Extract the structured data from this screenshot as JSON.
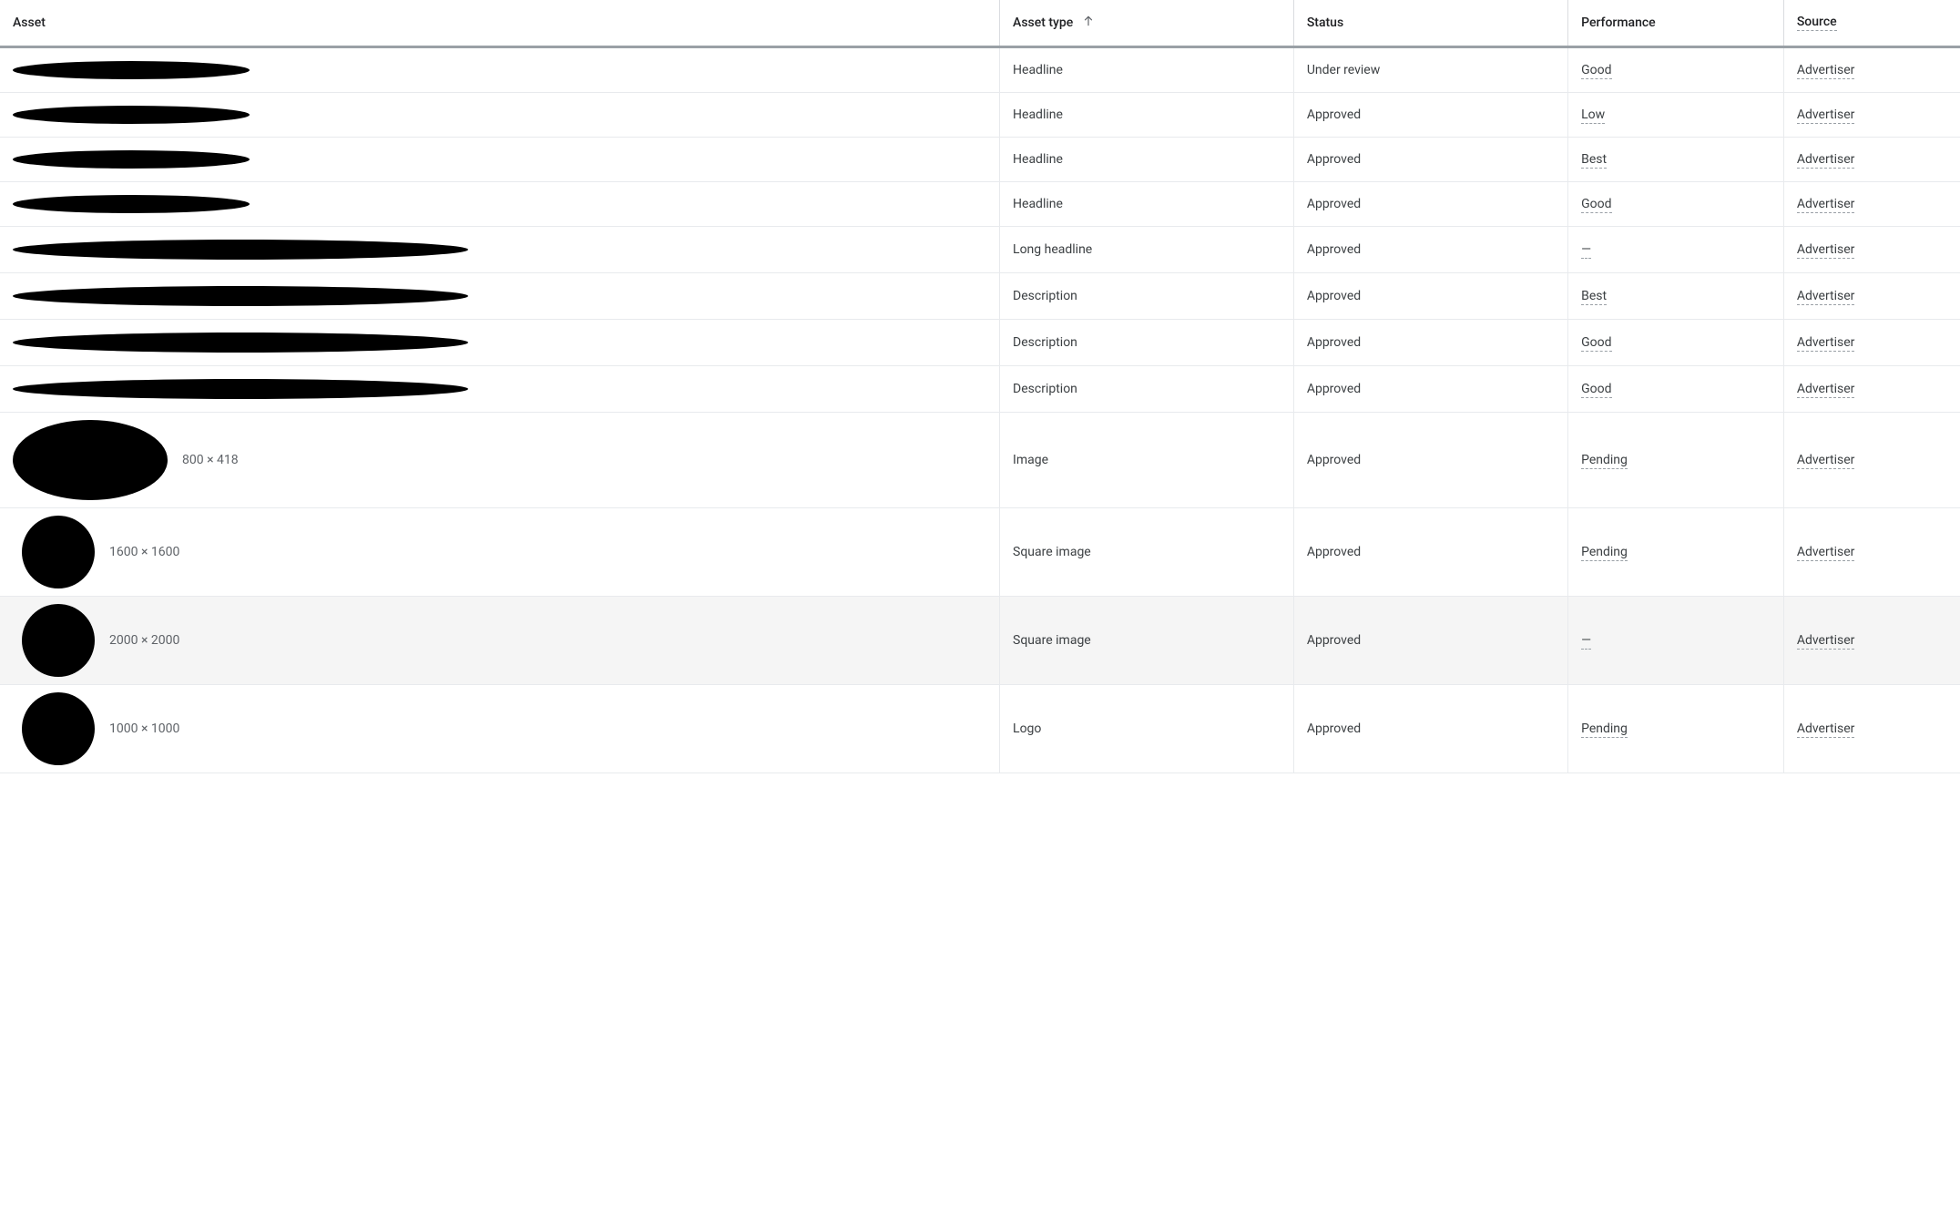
{
  "headers": {
    "asset": "Asset",
    "asset_type": "Asset type",
    "status": "Status",
    "performance": "Performance",
    "source": "Source"
  },
  "sort": {
    "column": "asset_type",
    "direction": "asc"
  },
  "rows": [
    {
      "kind": "text-short",
      "asset_type": "Headline",
      "status": "Under review",
      "performance": "Good",
      "source": "Advertiser",
      "highlighted": false
    },
    {
      "kind": "text-short",
      "asset_type": "Headline",
      "status": "Approved",
      "performance": "Low",
      "source": "Advertiser",
      "highlighted": false
    },
    {
      "kind": "text-short",
      "asset_type": "Headline",
      "status": "Approved",
      "performance": "Best",
      "source": "Advertiser",
      "highlighted": false
    },
    {
      "kind": "text-short",
      "asset_type": "Headline",
      "status": "Approved",
      "performance": "Good",
      "source": "Advertiser",
      "highlighted": false
    },
    {
      "kind": "text-long",
      "asset_type": "Long headline",
      "status": "Approved",
      "performance": "—",
      "source": "Advertiser",
      "highlighted": false
    },
    {
      "kind": "text-long",
      "asset_type": "Description",
      "status": "Approved",
      "performance": "Best",
      "source": "Advertiser",
      "highlighted": false
    },
    {
      "kind": "text-long",
      "asset_type": "Description",
      "status": "Approved",
      "performance": "Good",
      "source": "Advertiser",
      "highlighted": false
    },
    {
      "kind": "text-long",
      "asset_type": "Description",
      "status": "Approved",
      "performance": "Good",
      "source": "Advertiser",
      "highlighted": false
    },
    {
      "kind": "image-wide",
      "dimensions": "800 × 418",
      "asset_type": "Image",
      "status": "Approved",
      "performance": "Pending",
      "source": "Advertiser",
      "highlighted": false
    },
    {
      "kind": "image-square",
      "dimensions": "1600 × 1600",
      "asset_type": "Square image",
      "status": "Approved",
      "performance": "Pending",
      "source": "Advertiser",
      "highlighted": false
    },
    {
      "kind": "image-square",
      "dimensions": "2000 × 2000",
      "asset_type": "Square image",
      "status": "Approved",
      "performance": "—",
      "source": "Advertiser",
      "highlighted": true
    },
    {
      "kind": "image-square",
      "dimensions": "1000 × 1000",
      "asset_type": "Logo",
      "status": "Approved",
      "performance": "Pending",
      "source": "Advertiser",
      "highlighted": false
    }
  ]
}
